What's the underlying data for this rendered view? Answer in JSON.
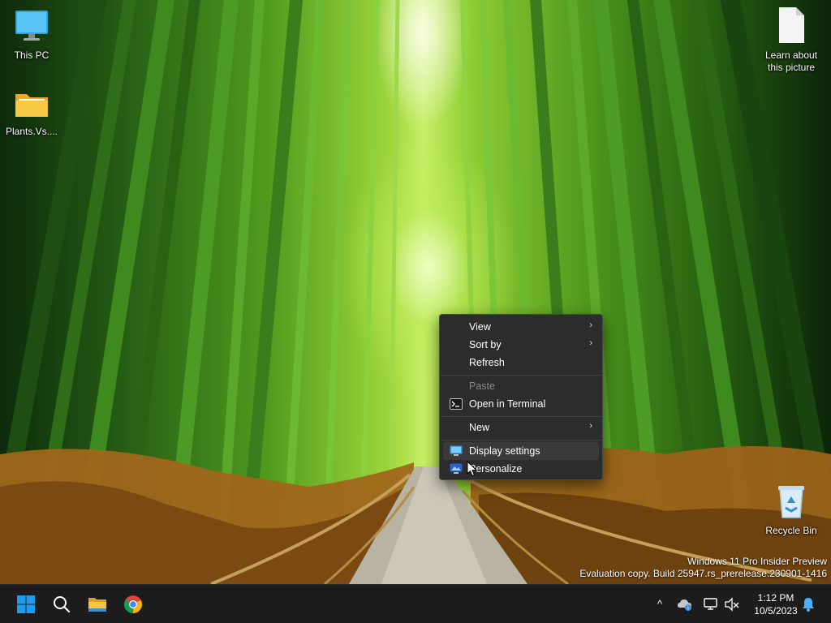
{
  "desktop": {
    "icons": [
      {
        "label": "This PC",
        "icon": "monitor-icon"
      },
      {
        "label": "Plants.Vs....",
        "icon": "folder-icon"
      },
      {
        "label": "Learn about this picture",
        "icon": "document-icon"
      },
      {
        "label": "Recycle Bin",
        "icon": "recycle-bin-icon"
      }
    ],
    "watermark": {
      "line1": "Windows 11 Pro Insider Preview",
      "line2": "Evaluation copy. Build 25947.rs_prerelease.230901-1416"
    }
  },
  "context_menu": {
    "items": [
      {
        "label": "View",
        "submenu": true,
        "enabled": true
      },
      {
        "label": "Sort by",
        "submenu": true,
        "enabled": true
      },
      {
        "label": "Refresh",
        "submenu": false,
        "enabled": true
      },
      {
        "label": "Paste",
        "submenu": false,
        "enabled": false
      },
      {
        "label": "Open in Terminal",
        "submenu": false,
        "enabled": true,
        "icon": "terminal-icon"
      },
      {
        "label": "New",
        "submenu": true,
        "enabled": true
      },
      {
        "label": "Display settings",
        "submenu": false,
        "enabled": true,
        "icon": "display-icon",
        "highlighted": true
      },
      {
        "label": "Personalize",
        "submenu": false,
        "enabled": true,
        "icon": "personalize-icon"
      }
    ],
    "chevron": "›"
  },
  "taskbar": {
    "apps": [
      {
        "name": "start",
        "icon": "windows-logo-icon"
      },
      {
        "name": "search",
        "icon": "search-icon"
      },
      {
        "name": "file-explorer",
        "icon": "folder-icon"
      },
      {
        "name": "chrome",
        "icon": "chrome-icon"
      }
    ],
    "tray": {
      "overflow_chevron": "^",
      "icons": [
        "onedrive-icon",
        "network-icon",
        "volume-muted-icon"
      ],
      "time": "1:12 PM",
      "date": "10/5/2023",
      "notification_icon": "bell-icon"
    }
  },
  "colors": {
    "taskbar_bg": "#1c1c1c",
    "menu_bg": "#2c2c2c",
    "accent_blue": "#0078d4"
  }
}
